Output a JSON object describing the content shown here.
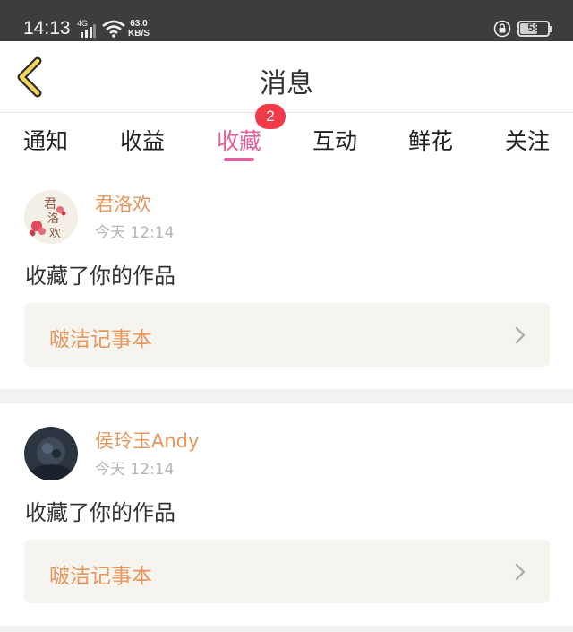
{
  "status_bar": {
    "time": "14:13",
    "network": "4G",
    "speed_value": "63.0",
    "speed_unit": "KB/S",
    "battery": "58"
  },
  "header": {
    "title": "消息",
    "back_icon": "chevron-left-icon"
  },
  "tabs": [
    {
      "label": "通知"
    },
    {
      "label": "收益"
    },
    {
      "label": "收藏",
      "active": true,
      "badge": "2"
    },
    {
      "label": "互动"
    },
    {
      "label": "鲜花"
    },
    {
      "label": "关注"
    }
  ],
  "colors": {
    "accent": "#e0609e",
    "username": "#e8965c",
    "badge": "#f23a48"
  },
  "feed": [
    {
      "user": "君洛欢",
      "time": "今天 12:14",
      "action": "收藏了你的作品",
      "work_title": "啵洁记事本"
    },
    {
      "user": "侯玲玉Andy",
      "time": "今天 12:14",
      "action": "收藏了你的作品",
      "work_title": "啵洁记事本"
    }
  ]
}
